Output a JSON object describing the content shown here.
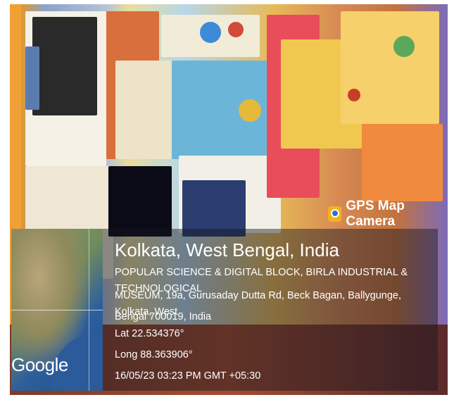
{
  "badge": {
    "label": "GPS Map Camera",
    "icon": "gps-map-camera-icon"
  },
  "location": {
    "title": "Kolkata, West Bengal, India",
    "address_line1": "POPULAR SCIENCE & DIGITAL BLOCK, BIRLA INDUSTRIAL & TECHNOLOGICAL",
    "address_line2": "MUSEUM, 19a, Gurusaday Dutta Rd, Beck Bagan, Ballygunge, Kolkata, West",
    "address_line3": "Bengal 700019, India",
    "lat": "Lat 22.534376°",
    "long": "Long 88.363906°",
    "datetime": "16/05/23 03:23 PM GMT +05:30"
  },
  "map": {
    "provider": "Google"
  }
}
